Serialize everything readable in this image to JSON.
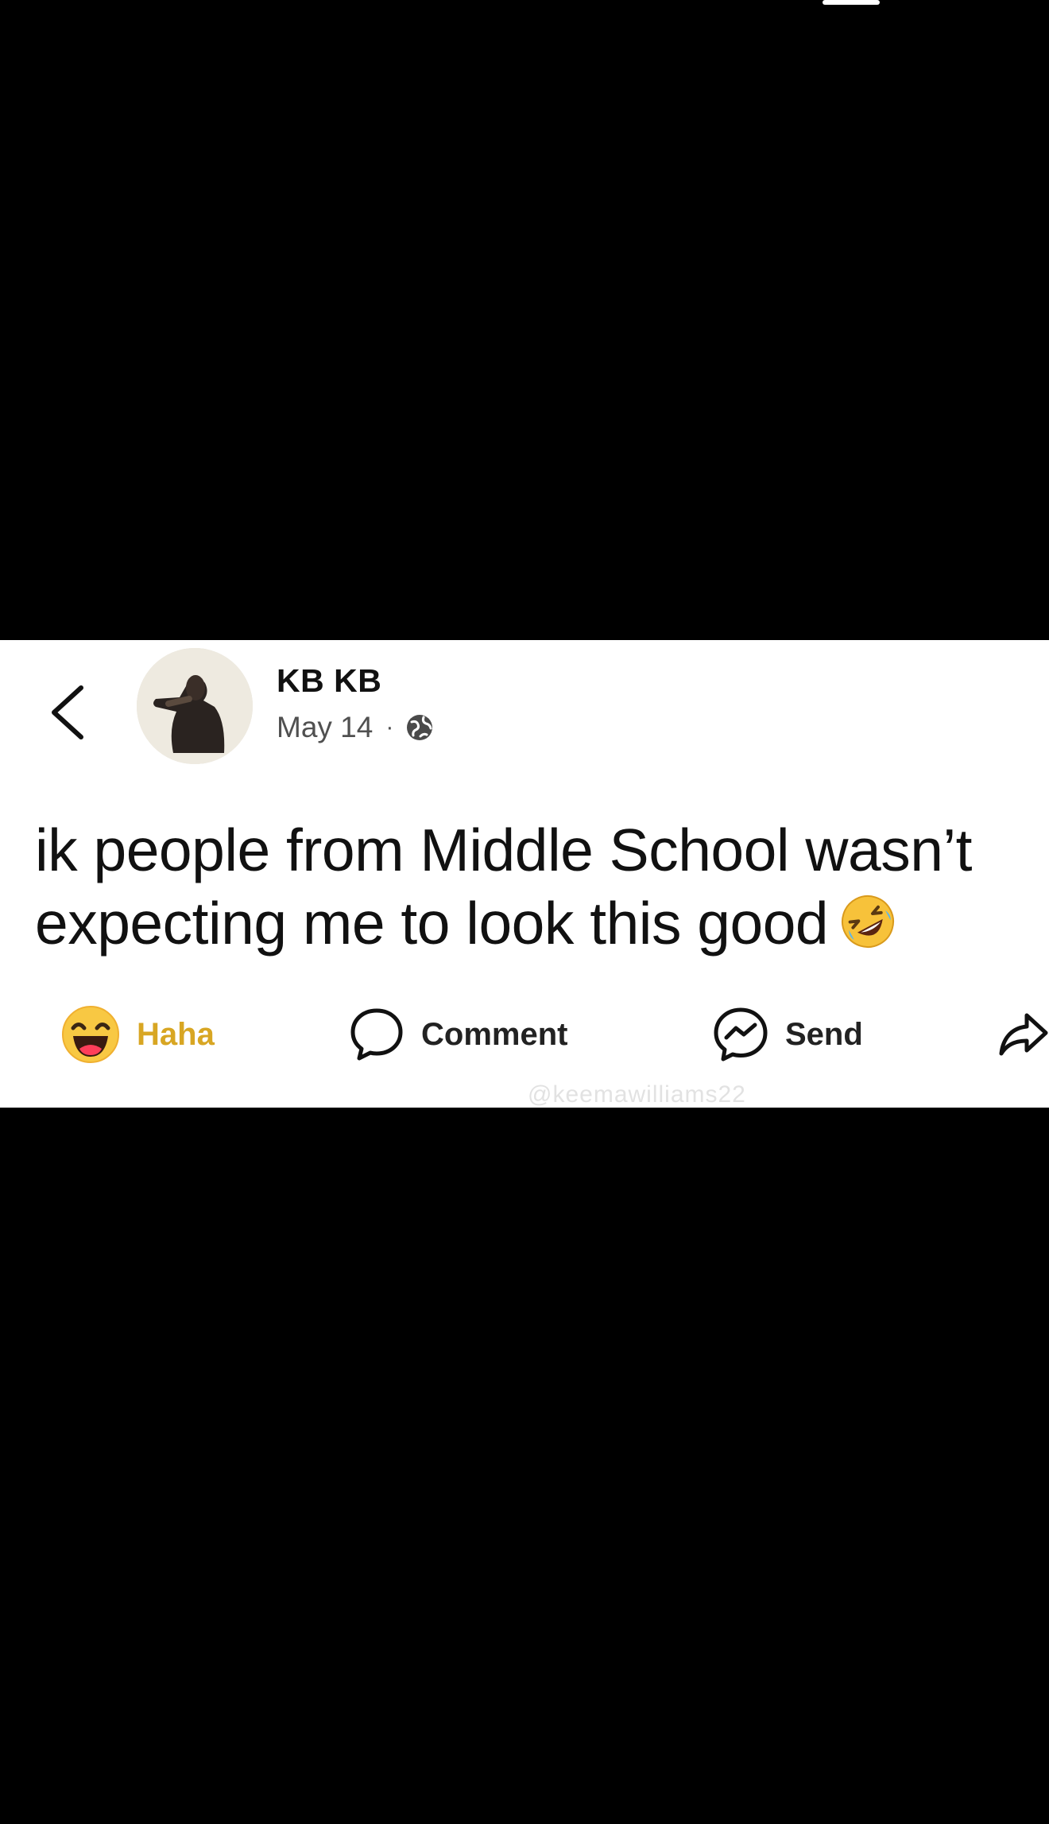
{
  "post": {
    "author": "KB KB",
    "date": "May 14",
    "separator": "·",
    "text": "ik people from Middle School wasn’t expecting me to look this good",
    "text_emoji_icon": "rolling-on-floor-laughing-emoji"
  },
  "actions": {
    "reaction_label": "Haha",
    "reaction_icon": "haha-emoji",
    "comment_label": "Comment",
    "comment_icon": "speech-bubble-icon",
    "send_label": "Send",
    "send_icon": "messenger-icon",
    "share_icon": "share-arrow-icon"
  },
  "watermark": "@keemawilliams22",
  "colors": {
    "background": "#000000",
    "card": "#ffffff",
    "text": "#111111",
    "haha": "#d8a623"
  }
}
